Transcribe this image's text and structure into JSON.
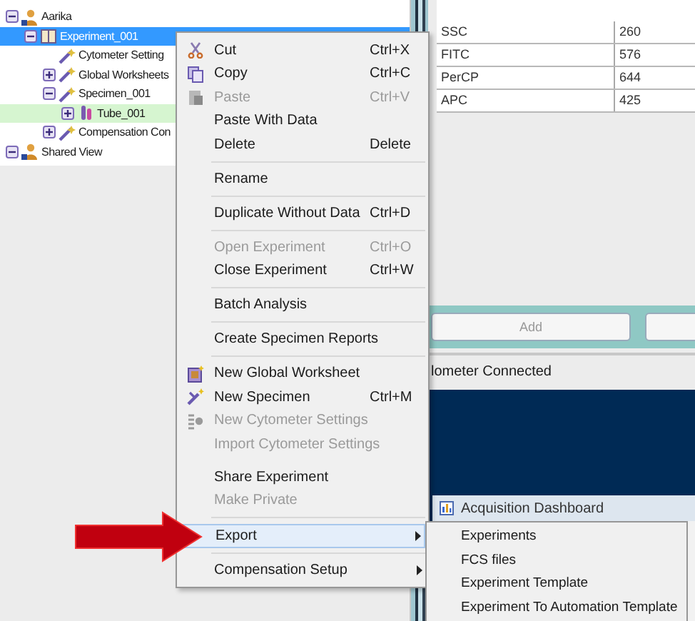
{
  "tree": [
    {
      "label": "Aarika",
      "expanded": true,
      "selected": false,
      "current": false,
      "children": [
        {
          "label": "Experiment_001",
          "expanded": true,
          "selected": true,
          "current": false,
          "children": [
            {
              "label": "Cytometer Setting",
              "selected": false,
              "current": false
            },
            {
              "label": "Global Worksheets",
              "expanded": false,
              "selected": false,
              "current": false
            },
            {
              "label": "Specimen_001",
              "expanded": true,
              "selected": false,
              "current": false,
              "children": [
                {
                  "label": "Tube_001",
                  "expanded": false,
                  "selected": false,
                  "current": true
                }
              ]
            },
            {
              "label": "Compensation Con",
              "expanded": false,
              "selected": false,
              "current": false
            }
          ]
        }
      ]
    },
    {
      "label": "Shared View",
      "expanded": true,
      "selected": false,
      "current": false
    }
  ],
  "parameters_table": {
    "rows": [
      {
        "name": "SSC",
        "value": "260"
      },
      {
        "name": "FITC",
        "value": "576"
      },
      {
        "name": "PerCP",
        "value": "644"
      },
      {
        "name": "APC",
        "value": "425"
      }
    ]
  },
  "buttons": [
    {
      "label": "Add",
      "disabled": true
    }
  ],
  "status": "lometer Connected",
  "dashboard": {
    "title": "Acquisition Dashboard"
  },
  "context_menu": [
    {
      "kind": "item",
      "label": "Cut",
      "shortcut": "Ctrl+X",
      "disabled": false
    },
    {
      "kind": "item",
      "label": "Copy",
      "shortcut": "Ctrl+C",
      "disabled": false
    },
    {
      "kind": "item",
      "label": "Paste",
      "shortcut": "Ctrl+V",
      "disabled": true
    },
    {
      "kind": "item",
      "label": "Paste With Data",
      "disabled": false
    },
    {
      "kind": "item",
      "label": "Delete",
      "shortcut": "Delete",
      "disabled": false
    },
    {
      "kind": "separator"
    },
    {
      "kind": "item",
      "label": "Rename",
      "disabled": false
    },
    {
      "kind": "separator"
    },
    {
      "kind": "item",
      "label": "Duplicate Without Data",
      "shortcut": "Ctrl+D",
      "disabled": false
    },
    {
      "kind": "separator"
    },
    {
      "kind": "item",
      "label": "Open Experiment",
      "shortcut": "Ctrl+O",
      "disabled": true
    },
    {
      "kind": "item",
      "label": "Close Experiment",
      "shortcut": "Ctrl+W",
      "disabled": false
    },
    {
      "kind": "separator"
    },
    {
      "kind": "item",
      "label": "Batch Analysis",
      "disabled": false
    },
    {
      "kind": "separator"
    },
    {
      "kind": "item",
      "label": "Create Specimen Reports",
      "disabled": false
    },
    {
      "kind": "separator"
    },
    {
      "kind": "item",
      "label": "New Global Worksheet",
      "disabled": false
    },
    {
      "kind": "item",
      "label": "New Specimen",
      "shortcut": "Ctrl+M",
      "disabled": false
    },
    {
      "kind": "item",
      "label": "New Cytometer Settings",
      "disabled": true
    },
    {
      "kind": "item",
      "label": "Import Cytometer Settings",
      "disabled": true
    },
    {
      "kind": "spacer"
    },
    {
      "kind": "item",
      "label": "Share Experiment",
      "disabled": false
    },
    {
      "kind": "item",
      "label": "Make Private",
      "disabled": true
    },
    {
      "kind": "separator"
    },
    {
      "kind": "item",
      "label": "Export",
      "disabled": false,
      "submenu": true,
      "selected": true
    },
    {
      "kind": "separator"
    },
    {
      "kind": "item",
      "label": "Compensation Setup",
      "disabled": false,
      "submenu": true,
      "selected": false
    }
  ],
  "submenu": [
    {
      "label": "Experiments"
    },
    {
      "label": "FCS files"
    },
    {
      "label": "Experiment Template"
    },
    {
      "label": "Experiment To Automation Template"
    }
  ]
}
